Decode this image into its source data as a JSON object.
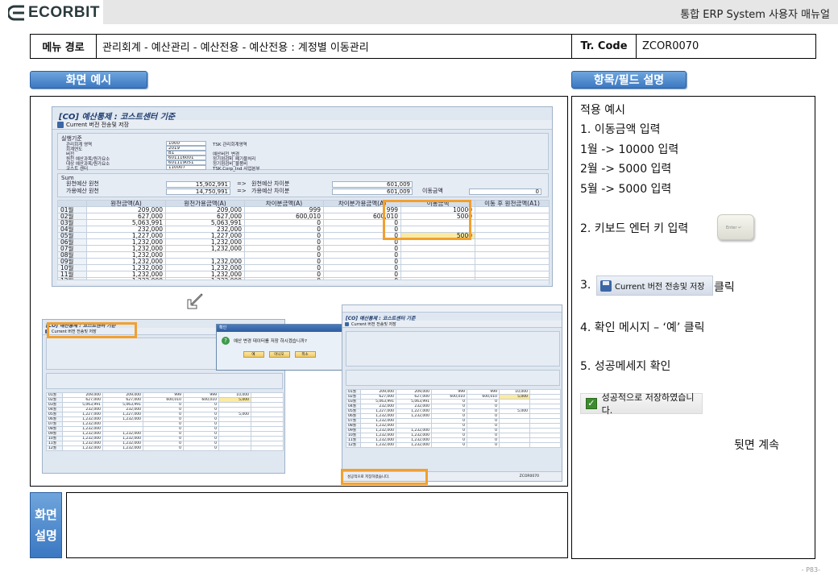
{
  "header": {
    "logo_text": "ECORBIT",
    "title": "통합 ERP System 사용자 매뉴얼"
  },
  "menu": {
    "path_label": "메뉴 경로",
    "path": "관리회계 - 예산관리 - 예산전용 - 예산전용 : 계정별 이동관리",
    "tr_label": "Tr. Code",
    "tr_code": "ZCOR0070"
  },
  "sections": {
    "screen_example": "화면 예시",
    "field_desc": "항목/필드 설명",
    "screen_expl_line1": "화면",
    "screen_expl_line2": "설명"
  },
  "description": {
    "lines": [
      "적용 예시",
      "1. 이동금액 입력",
      "1월 -> 10000 입력",
      "2월 -> 5000 입력",
      "5월 -> 5000 입력",
      "2. 키보드 엔터 키 입력",
      "3.",
      "클릭",
      "4. 확인 메시지 – ‘예’ 클릭",
      "5. 성공메세지 확인",
      "뒷면 계속"
    ],
    "button_label": "Current 버전 전송및 저장",
    "success_message": "성공적으로 저장하였습니다.",
    "enter_key_label": "Enter ↵"
  },
  "sap_main": {
    "title": "[CO] 예산통제 : 코스트센터 기준",
    "toolbar_button": "Current 버전 전송및 저장",
    "panel_title": "실행기준",
    "fields": [
      {
        "label": "관리회계 영역",
        "value": "1000",
        "text": "TSK 관리회계영역"
      },
      {
        "label": "회계연도",
        "value": "2019",
        "text": ""
      },
      {
        "label": "버전",
        "value": "B1",
        "text": "예산버전_변경"
      },
      {
        "label": "원천 예산과목/원가요소",
        "value": "601116001",
        "text": "정기점검비_폐기물처리"
      },
      {
        "label": "대상 예산과목/원가요소",
        "value": "601119051",
        "text": "정기점검비_물품비"
      },
      {
        "label": "코스트 센터",
        "value": "110007",
        "text": "TSK.Corp_Ind 사업본부"
      }
    ],
    "sum_title": "Sum",
    "sum_rows": [
      {
        "label": "원천예산 원천",
        "value": "15,902,991",
        "arrow": "=>",
        "label2": "원천예산 차이분",
        "value2": "601,009"
      },
      {
        "label": "가용예산 원천",
        "value": "14,750,991",
        "arrow": "=>",
        "label2": "가용예산 차이분",
        "value2": "601,009",
        "label3": "이동금액",
        "value3": "0"
      }
    ],
    "columns": [
      "",
      "원천금액(A)",
      "원천가용금액(A)",
      "차이분금액(A)",
      "차이분가용금액(A)",
      "이동금액",
      "이동 후 원천금액(A1)"
    ],
    "rows": [
      {
        "m": "01월",
        "a": "209,000",
        "b": "209,000",
        "c": "999",
        "d": "999",
        "e": "10000",
        "f": ""
      },
      {
        "m": "02월",
        "a": "627,000",
        "b": "627,000",
        "c": "600,010",
        "d": "600,010",
        "e": "5000",
        "f": ""
      },
      {
        "m": "03월",
        "a": "5,063,991",
        "b": "5,063,991",
        "c": "0",
        "d": "0",
        "e": "",
        "f": ""
      },
      {
        "m": "04월",
        "a": "232,000",
        "b": "232,000",
        "c": "0",
        "d": "0",
        "e": "",
        "f": ""
      },
      {
        "m": "05월",
        "a": "1,227,000",
        "b": "1,227,000",
        "c": "0",
        "d": "0",
        "e": "5000",
        "f": ""
      },
      {
        "m": "06월",
        "a": "1,232,000",
        "b": "1,232,000",
        "c": "0",
        "d": "0",
        "e": "",
        "f": ""
      },
      {
        "m": "07월",
        "a": "1,232,000",
        "b": "1,232,000",
        "c": "0",
        "d": "0",
        "e": "",
        "f": ""
      },
      {
        "m": "08월",
        "a": "1,232,000",
        "b": "",
        "c": "0",
        "d": "0",
        "e": "",
        "f": ""
      },
      {
        "m": "09월",
        "a": "1,232,000",
        "b": "1,232,000",
        "c": "0",
        "d": "0",
        "e": "",
        "f": ""
      },
      {
        "m": "10월",
        "a": "1,232,000",
        "b": "1,232,000",
        "c": "0",
        "d": "0",
        "e": "",
        "f": ""
      },
      {
        "m": "11월",
        "a": "1,232,000",
        "b": "1,232,000",
        "c": "0",
        "d": "0",
        "e": "",
        "f": ""
      },
      {
        "m": "12월",
        "a": "1,232,000",
        "b": "1,232,000",
        "c": "0",
        "d": "0",
        "e": "",
        "f": ""
      }
    ]
  },
  "sap_small": {
    "title": "[CO] 예산통제 : 코스트센터 기준",
    "toolbar_button": "Current 버전 전송및 저장",
    "rows": [
      {
        "m": "01월",
        "a": "209,000",
        "b": "209,000",
        "c": "999",
        "d": "999",
        "e": "10,000"
      },
      {
        "m": "02월",
        "a": "627,000",
        "b": "627,000",
        "c": "600,010",
        "d": "600,010",
        "e": "5,000"
      },
      {
        "m": "03월",
        "a": "5,063,991",
        "b": "5,063,991",
        "c": "0",
        "d": "0",
        "e": ""
      },
      {
        "m": "04월",
        "a": "232,000",
        "b": "232,000",
        "c": "0",
        "d": "0",
        "e": ""
      },
      {
        "m": "05월",
        "a": "1,227,000",
        "b": "1,227,000",
        "c": "0",
        "d": "0",
        "e": "5,000"
      },
      {
        "m": "06월",
        "a": "1,232,000",
        "b": "1,232,000",
        "c": "0",
        "d": "0",
        "e": ""
      },
      {
        "m": "07월",
        "a": "1,232,000",
        "b": "",
        "c": "0",
        "d": "0",
        "e": ""
      },
      {
        "m": "08월",
        "a": "1,232,000",
        "b": "",
        "c": "0",
        "d": "0",
        "e": ""
      },
      {
        "m": "09월",
        "a": "1,232,000",
        "b": "1,232,000",
        "c": "0",
        "d": "0",
        "e": ""
      },
      {
        "m": "10월",
        "a": "1,232,000",
        "b": "1,232,000",
        "c": "0",
        "d": "0",
        "e": ""
      },
      {
        "m": "11월",
        "a": "1,232,000",
        "b": "1,232,000",
        "c": "0",
        "d": "0",
        "e": ""
      },
      {
        "m": "12월",
        "a": "1,232,000",
        "b": "1,232,000",
        "c": "0",
        "d": "0",
        "e": ""
      }
    ],
    "dialog_title": "확인",
    "dialog_message": "예산 변경 데이터를 저장 하시겠습니까?",
    "dialog_yes": "예",
    "dialog_no": "아니오",
    "dialog_cancel": "취소",
    "status_message": "성공적으로 저장하였습니다.",
    "system_code": "ZCOR0070"
  },
  "page_number": "- P83-",
  "colors": {
    "accent_blue": "#3b78c2",
    "highlight_orange": "#f0a030",
    "header_gray": "#e6e6e6"
  }
}
